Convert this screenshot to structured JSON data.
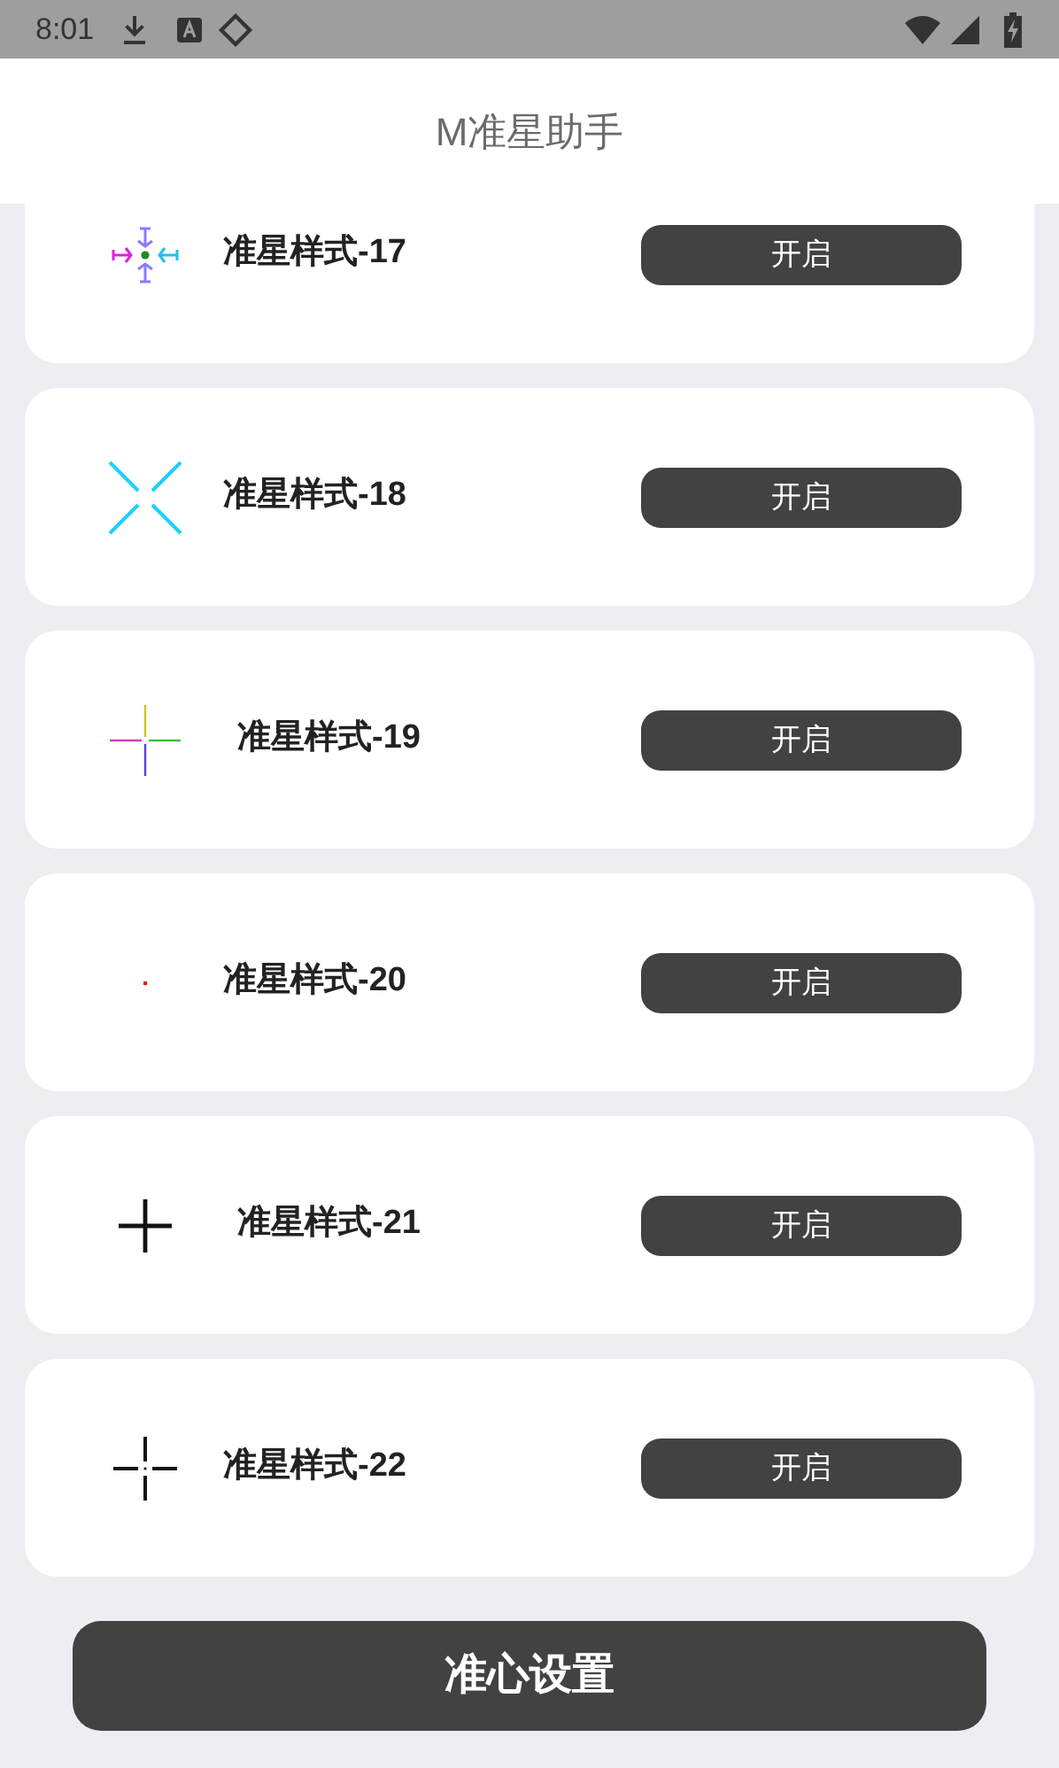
{
  "status_bar": {
    "time": "8:01"
  },
  "app_bar": {
    "title": "M准星助手"
  },
  "items": [
    {
      "kind": "arrows",
      "label": "准星样式-17",
      "button": "开启"
    },
    {
      "kind": "x",
      "label": "准星样式-18",
      "button": "开启"
    },
    {
      "kind": "rainbow",
      "label": "准星样式-19",
      "button": "开启"
    },
    {
      "kind": "dot",
      "label": "准星样式-20",
      "button": "开启"
    },
    {
      "kind": "plus",
      "label": "准星样式-21",
      "button": "开启"
    },
    {
      "kind": "gap",
      "label": "准星样式-22",
      "button": "开启"
    }
  ],
  "footer_button": "准心设置"
}
